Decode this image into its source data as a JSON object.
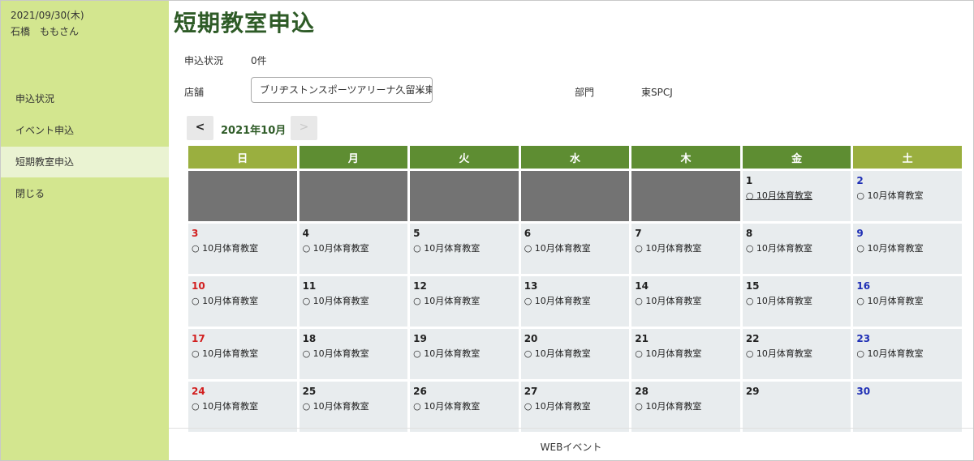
{
  "sidebar": {
    "date": "2021/09/30(木)",
    "user": "石橋　ももさん",
    "items": [
      {
        "label": "申込状況"
      },
      {
        "label": "イベント申込"
      },
      {
        "label": "短期教室申込"
      },
      {
        "label": "閉じる"
      }
    ]
  },
  "main": {
    "title": "短期教室申込",
    "status_label": "申込状況",
    "status_value": "0件",
    "store_label": "店舗",
    "store_selected": "ブリヂストンスポーツアリーナ久留米東",
    "dept_label": "部門",
    "dept_value": "東SPCJ"
  },
  "calendar": {
    "prev_label": "<",
    "next_label": ">",
    "month": "2021年10月",
    "weekdays": [
      "日",
      "月",
      "火",
      "水",
      "木",
      "金",
      "土"
    ],
    "event_text": "○ 10月体育教室",
    "weeks": [
      [
        null,
        null,
        null,
        null,
        null,
        {
          "day": "1",
          "event": true
        },
        {
          "day": "2",
          "event": true
        }
      ],
      [
        {
          "day": "3",
          "event": true
        },
        {
          "day": "4",
          "event": true
        },
        {
          "day": "5",
          "event": true
        },
        {
          "day": "6",
          "event": true
        },
        {
          "day": "7",
          "event": true
        },
        {
          "day": "8",
          "event": true
        },
        {
          "day": "9",
          "event": true
        }
      ],
      [
        {
          "day": "10",
          "event": true
        },
        {
          "day": "11",
          "event": true
        },
        {
          "day": "12",
          "event": true
        },
        {
          "day": "13",
          "event": true
        },
        {
          "day": "14",
          "event": true
        },
        {
          "day": "15",
          "event": true
        },
        {
          "day": "16",
          "event": true
        }
      ],
      [
        {
          "day": "17",
          "event": true
        },
        {
          "day": "18",
          "event": true
        },
        {
          "day": "19",
          "event": true
        },
        {
          "day": "20",
          "event": true
        },
        {
          "day": "21",
          "event": true
        },
        {
          "day": "22",
          "event": true
        },
        {
          "day": "23",
          "event": true
        }
      ],
      [
        {
          "day": "24",
          "event": true
        },
        {
          "day": "25",
          "event": true
        },
        {
          "day": "26",
          "event": true
        },
        {
          "day": "27",
          "event": true
        },
        {
          "day": "28",
          "event": true
        },
        {
          "day": "29",
          "event": false
        },
        {
          "day": "30",
          "event": false
        }
      ]
    ]
  },
  "footer": {
    "text": "WEBイベント"
  },
  "colors": {
    "sidebar_bg": "#d3e68f",
    "title_green": "#2e5b27",
    "header_weekday": "#5e8d32",
    "header_weekend": "#9aaf3f",
    "sunday": "#d21f1f",
    "saturday": "#1f2fb5"
  }
}
